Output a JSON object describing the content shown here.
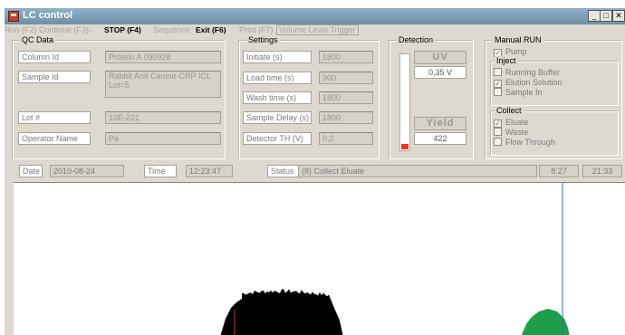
{
  "window": {
    "title": "LC control",
    "controls": {
      "minimize": "_",
      "maximize": "□",
      "close": "✕"
    }
  },
  "menu": {
    "run": "Run (F2)",
    "continue": "Continue (F3)",
    "stop": "STOP (F4)",
    "sequence": "Sequence",
    "exit": "Exit (F6)",
    "print": "Print (F7)",
    "volume": "Volume Level Trigger"
  },
  "qc": {
    "title": "QC Data",
    "column_label": "Column Id",
    "column_value": "Protein A 090928",
    "sample_label": "Sample Id",
    "sample_value": "Rabbit Anti Canine-CRP ICL Lot=5",
    "lot_label": "Lot #",
    "lot_value": "10E-221",
    "operator_label": "Operator Name",
    "operator_value": "Pa"
  },
  "settings": {
    "title": "Settings",
    "initiate_label": "Initiate (s)",
    "initiate_value": "1800",
    "load_label": "Load time (s)",
    "load_value": "900",
    "wash_label": "Wash time (s)",
    "wash_value": "1800",
    "delay_label": "Sample Delay (s)",
    "delay_value": "1800",
    "detector_label": "Detector TH (V)",
    "detector_value": "0,2"
  },
  "detection": {
    "title": "Detection",
    "uv_label": "UV",
    "uv_value": "0,35 V",
    "yield_label": "Yield",
    "yield_value": "422",
    "level_fraction": 0.06,
    "gauge_color": "#e8391a"
  },
  "manual": {
    "title": "Manual RUN",
    "pump_label": "Pump",
    "pump_checked": true,
    "inject_title": "Inject",
    "inject_items": [
      {
        "label": "Running Buffer",
        "checked": false
      },
      {
        "label": "Elution Solution",
        "checked": true
      },
      {
        "label": "Sample In",
        "checked": false
      }
    ],
    "collect_title": "Collect",
    "collect_items": [
      {
        "label": "Eluate",
        "checked": true
      },
      {
        "label": "Waste",
        "checked": false
      },
      {
        "label": "Flow Through",
        "checked": false
      }
    ]
  },
  "status_bar": {
    "date_label": "Date",
    "date_value": "2010-08-24",
    "time_label": "Time",
    "time_value": "12:23:47",
    "status_label": "Status",
    "status_value": "(8) Collect Eluate",
    "elapsed": "8:27",
    "total": "21:33"
  },
  "chart_data": {
    "type": "area",
    "title": "",
    "series": [
      {
        "values": [],
        "color": "#000000"
      },
      {
        "values": [],
        "color": "#1e9e4a"
      }
    ],
    "cursor_color": "#2a6fb0",
    "marker_color": "#c0402c"
  }
}
